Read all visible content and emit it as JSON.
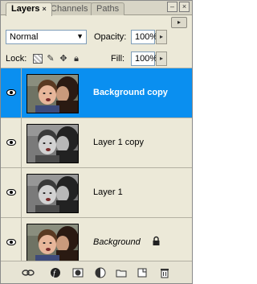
{
  "tabs": {
    "layers": "Layers",
    "channels": "Channels",
    "paths": "Paths",
    "close_glyph": "×"
  },
  "window": {
    "minimize_glyph": "–",
    "close_glyph": "×",
    "menu_glyph": "▸"
  },
  "blend_mode": {
    "value": "Normal",
    "dropdown_glyph": "▼"
  },
  "opacity": {
    "label": "Opacity:",
    "value": "100%",
    "arrow_glyph": "▸"
  },
  "lock": {
    "label": "Lock:"
  },
  "fill": {
    "label": "Fill:",
    "value": "100%",
    "arrow_glyph": "▸"
  },
  "layers": [
    {
      "name": "Background copy",
      "selected": true,
      "thumbnail": "color",
      "locked": false
    },
    {
      "name": "Layer 1 copy",
      "selected": false,
      "thumbnail": "grayscale",
      "locked": false
    },
    {
      "name": "Layer 1",
      "selected": false,
      "thumbnail": "grayscale",
      "locked": false
    },
    {
      "name": "Background",
      "selected": false,
      "thumbnail": "color",
      "locked": true
    }
  ],
  "footer_icons": [
    "link-icon",
    "layer-style-icon",
    "mask-icon",
    "adjustment-icon",
    "group-folder-icon",
    "new-layer-icon",
    "trash-icon"
  ],
  "colors": {
    "selection": "#0a8ff0",
    "panel_bg": "#ece9d8"
  }
}
